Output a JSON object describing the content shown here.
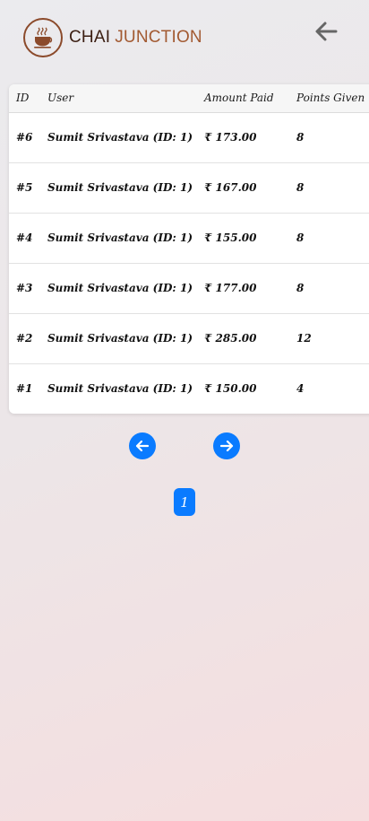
{
  "header": {
    "brand_part1": "CHAI",
    "brand_part2": "JUNCTION",
    "logo_icon": "coffee-cup-icon",
    "back_icon": "arrow-left-icon"
  },
  "table": {
    "columns": [
      "ID",
      "User",
      "Amount Paid",
      "Points Given"
    ],
    "rows": [
      {
        "id": "#6",
        "user": "Sumit Srivastava (ID: 1)",
        "amount": "₹ 173.00",
        "points": "8"
      },
      {
        "id": "#5",
        "user": "Sumit Srivastava (ID: 1)",
        "amount": "₹ 167.00",
        "points": "8"
      },
      {
        "id": "#4",
        "user": "Sumit Srivastava (ID: 1)",
        "amount": "₹ 155.00",
        "points": "8"
      },
      {
        "id": "#3",
        "user": "Sumit Srivastava (ID: 1)",
        "amount": "₹ 177.00",
        "points": "8"
      },
      {
        "id": "#2",
        "user": "Sumit Srivastava (ID: 1)",
        "amount": "₹ 285.00",
        "points": "12"
      },
      {
        "id": "#1",
        "user": "Sumit Srivastava (ID: 1)",
        "amount": "₹ 150.00",
        "points": "4"
      }
    ]
  },
  "pagination": {
    "prev_icon": "arrow-left-icon",
    "next_icon": "arrow-right-icon",
    "current_page": "1"
  },
  "colors": {
    "accent": "#0a7bff",
    "brand_dark": "#3b1e12",
    "brand_light": "#a25a32"
  }
}
